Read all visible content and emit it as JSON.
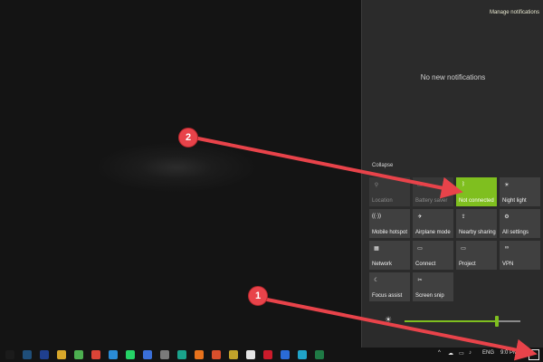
{
  "action_center": {
    "manage_notifications": "Manage notifications",
    "no_notifications": "No new notifications",
    "collapse": "Collapse",
    "tiles": [
      {
        "label": "Location",
        "icon": "location-icon",
        "state": "disabled"
      },
      {
        "label": "Battery saver",
        "icon": "battery-icon",
        "state": "disabled"
      },
      {
        "label": "Not connected",
        "icon": "bluetooth-icon",
        "state": "active"
      },
      {
        "label": "Night light",
        "icon": "night-light-icon",
        "state": "normal"
      },
      {
        "label": "Mobile hotspot",
        "icon": "hotspot-icon",
        "state": "normal"
      },
      {
        "label": "Airplane mode",
        "icon": "airplane-icon",
        "state": "normal"
      },
      {
        "label": "Nearby sharing",
        "icon": "share-icon",
        "state": "normal"
      },
      {
        "label": "All settings",
        "icon": "gear-icon",
        "state": "normal"
      },
      {
        "label": "Network",
        "icon": "network-icon",
        "state": "normal"
      },
      {
        "label": "Connect",
        "icon": "connect-icon",
        "state": "normal"
      },
      {
        "label": "Project",
        "icon": "project-icon",
        "state": "normal"
      },
      {
        "label": "VPN",
        "icon": "vpn-icon",
        "state": "normal"
      },
      {
        "label": "Focus assist",
        "icon": "moon-icon",
        "state": "normal"
      },
      {
        "label": "Screen snip",
        "icon": "snip-icon",
        "state": "normal"
      }
    ],
    "brightness_level": 0.8,
    "accent_color": "#7fbf1f"
  },
  "taskbar": {
    "language": "ENG",
    "clock": "9:0 PM",
    "apps": [
      {
        "name": "start-icon",
        "color": "#1b1b1b"
      },
      {
        "name": "taskview-icon",
        "color": "#1f4e79"
      },
      {
        "name": "photoshop-icon",
        "color": "#1f3f8f"
      },
      {
        "name": "explorer-icon",
        "color": "#d8a72a"
      },
      {
        "name": "chrome-icon",
        "color": "#4caf50"
      },
      {
        "name": "chrome-alt-icon",
        "color": "#db4437"
      },
      {
        "name": "vscode-icon",
        "color": "#2a8cd8"
      },
      {
        "name": "whatsapp-icon",
        "color": "#25d366"
      },
      {
        "name": "app-icon",
        "color": "#3a6fd8"
      },
      {
        "name": "app-icon",
        "color": "#7a7a7a"
      },
      {
        "name": "app-icon",
        "color": "#1aa38c"
      },
      {
        "name": "firefox-icon",
        "color": "#e8721c"
      },
      {
        "name": "app-icon",
        "color": "#d94f2c"
      },
      {
        "name": "app-icon",
        "color": "#c2a32a"
      },
      {
        "name": "app-icon",
        "color": "#e5e5e5"
      },
      {
        "name": "opera-icon",
        "color": "#cc1b2b"
      },
      {
        "name": "app-icon",
        "color": "#2a6bd8"
      },
      {
        "name": "app-icon",
        "color": "#20a4c8"
      },
      {
        "name": "excel-icon",
        "color": "#1f7a45"
      }
    ]
  },
  "annotations": [
    {
      "number": "1"
    },
    {
      "number": "2"
    }
  ]
}
